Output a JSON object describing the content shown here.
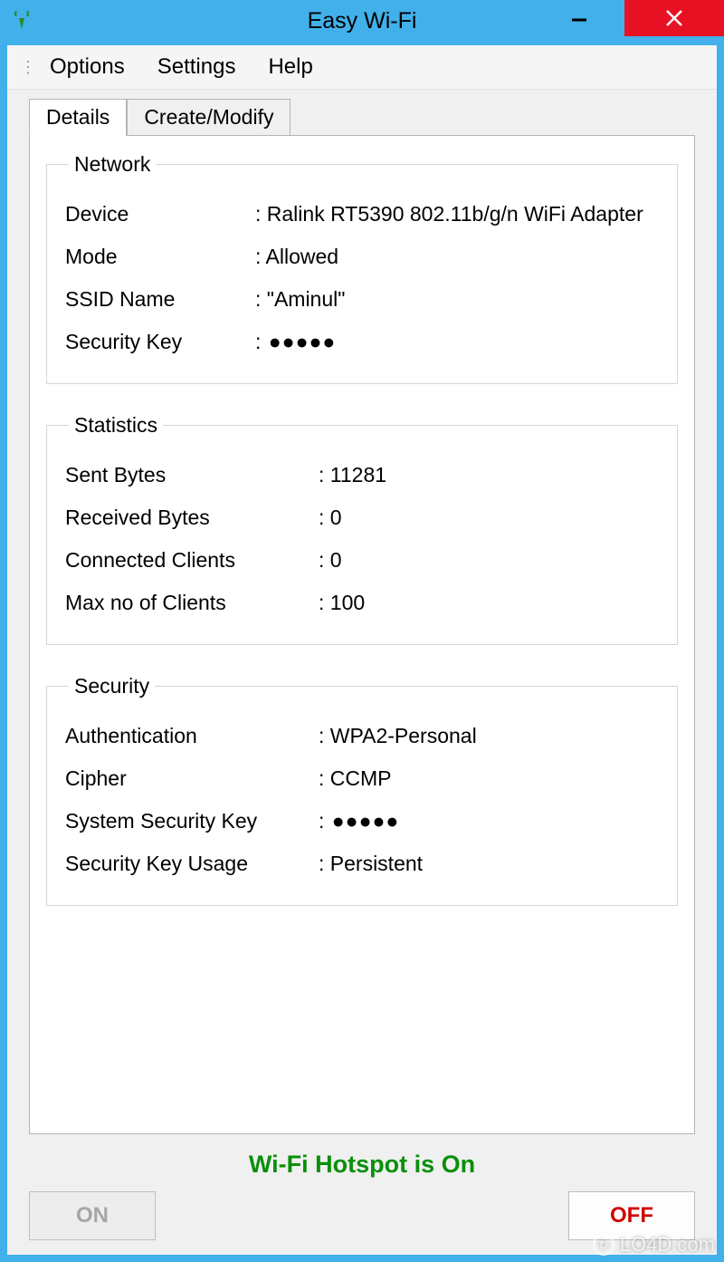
{
  "titlebar": {
    "title": "Easy Wi-Fi"
  },
  "menu": {
    "options": "Options",
    "settings": "Settings",
    "help": "Help"
  },
  "tabs": {
    "details": "Details",
    "create_modify": "Create/Modify"
  },
  "network": {
    "legend": "Network",
    "device_label": "Device",
    "device_value": "Ralink RT5390 802.11b/g/n WiFi Adapter",
    "mode_label": "Mode",
    "mode_value": "Allowed",
    "ssid_label": "SSID Name",
    "ssid_value": "\"Aminul\"",
    "key_label": "Security Key",
    "key_value": "●●●●●"
  },
  "statistics": {
    "legend": "Statistics",
    "sent_label": "Sent Bytes",
    "sent_value": "11281",
    "recv_label": "Received Bytes",
    "recv_value": "0",
    "clients_label": "Connected Clients",
    "clients_value": "0",
    "max_label": "Max no of Clients",
    "max_value": "100"
  },
  "security": {
    "legend": "Security",
    "auth_label": "Authentication",
    "auth_value": "WPA2-Personal",
    "cipher_label": "Cipher",
    "cipher_value": "CCMP",
    "syskey_label": "System Security Key",
    "syskey_value": "●●●●●",
    "usage_label": "Security Key Usage",
    "usage_value": "Persistent"
  },
  "status": {
    "text": "Wi-Fi Hotspot is On"
  },
  "buttons": {
    "on": "ON",
    "off": "OFF"
  },
  "watermark": {
    "text": "LO4D.com"
  }
}
